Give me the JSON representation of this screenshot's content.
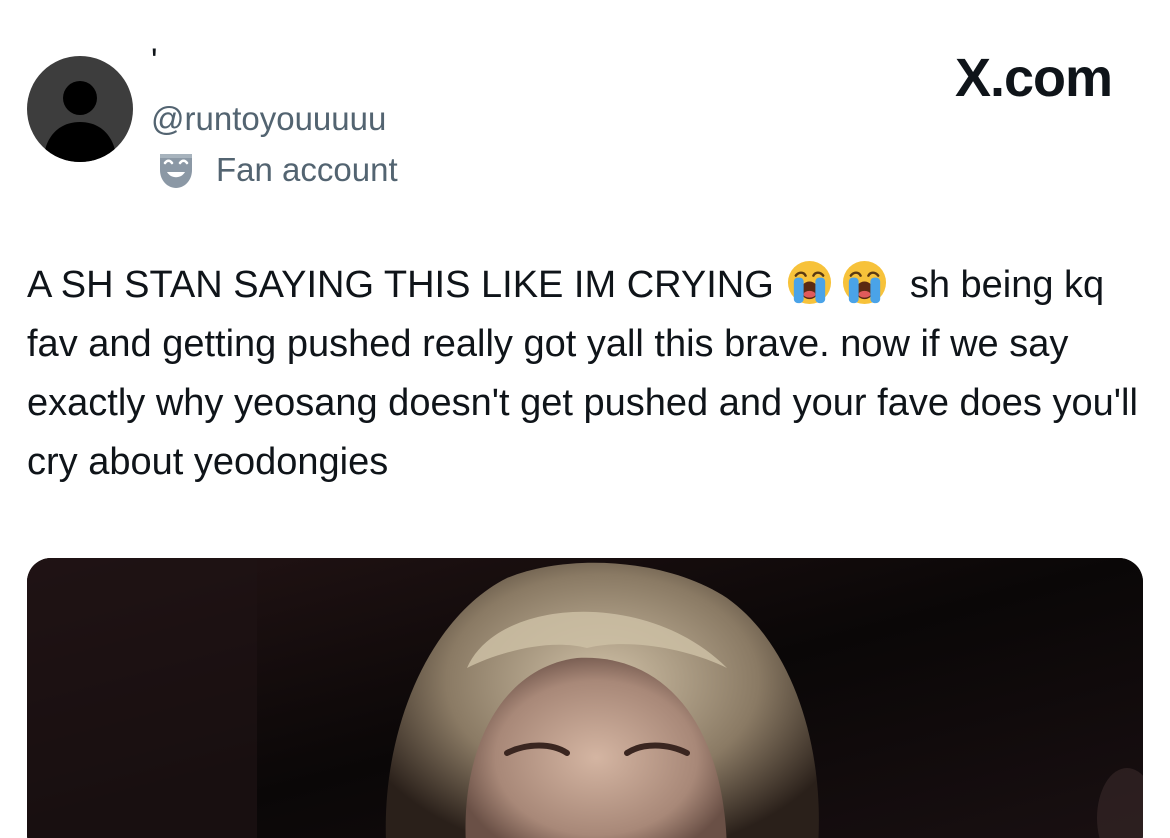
{
  "brand": {
    "label": "X.com"
  },
  "author": {
    "display_name": "'",
    "handle": "@runtoyouuuuu",
    "account_label": "Fan account",
    "label_icon": "theater-mask-icon",
    "avatar_icon": "default-user-icon"
  },
  "tweet": {
    "text_part1": "A SH STAN SAYING THIS LIKE IM CRYING",
    "emojis": [
      "loudly-crying-face",
      "loudly-crying-face"
    ],
    "text_part2": "sh being kq fav and getting pushed really got yall this brave. now if we say exactly why yeosang doesn't get pushed and your fave does you'll cry about yeodongies"
  },
  "media": {
    "type": "video-still",
    "description_icon": "photo-icon"
  },
  "colors": {
    "text_primary": "#0f1419",
    "text_secondary": "#536471",
    "avatar_bg": "#3d3d3d",
    "media_bg": "#0c0808"
  }
}
